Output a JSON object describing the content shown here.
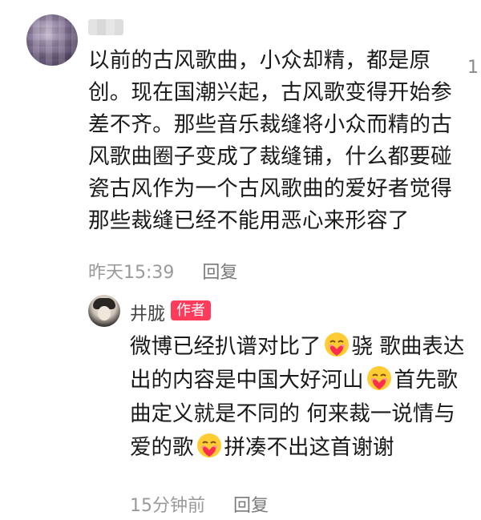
{
  "comment": {
    "text": "以前的古风歌曲，小众却精，都是原创。现在国潮兴起，古风歌变得开始参差不齐。那些音乐裁缝将小众而精的古风歌曲圈子变成了裁缝铺，什么都要碰瓷古风作为一个古风歌曲的爱好者觉得那些裁缝已经不能用恶心来形容了",
    "time": "昨天15:39",
    "reply_label": "回复",
    "like_count": "1"
  },
  "reply": {
    "username": "井胧",
    "badge": "作者",
    "segments": [
      "微博已经扒谱对比了",
      "骁 歌曲表达出的内容是中国大好河山",
      "首先歌曲定义就是不同的 何来裁一说情与爱的歌",
      "拼凑不出这首谢谢"
    ],
    "emoji_name": "heart-hug-emoji",
    "time": "15分钟前",
    "reply_label": "回复"
  },
  "colors": {
    "badge_bg": "#ff3b5c",
    "meta_text": "#9a9a9a",
    "body_text": "#1a1a1a"
  }
}
